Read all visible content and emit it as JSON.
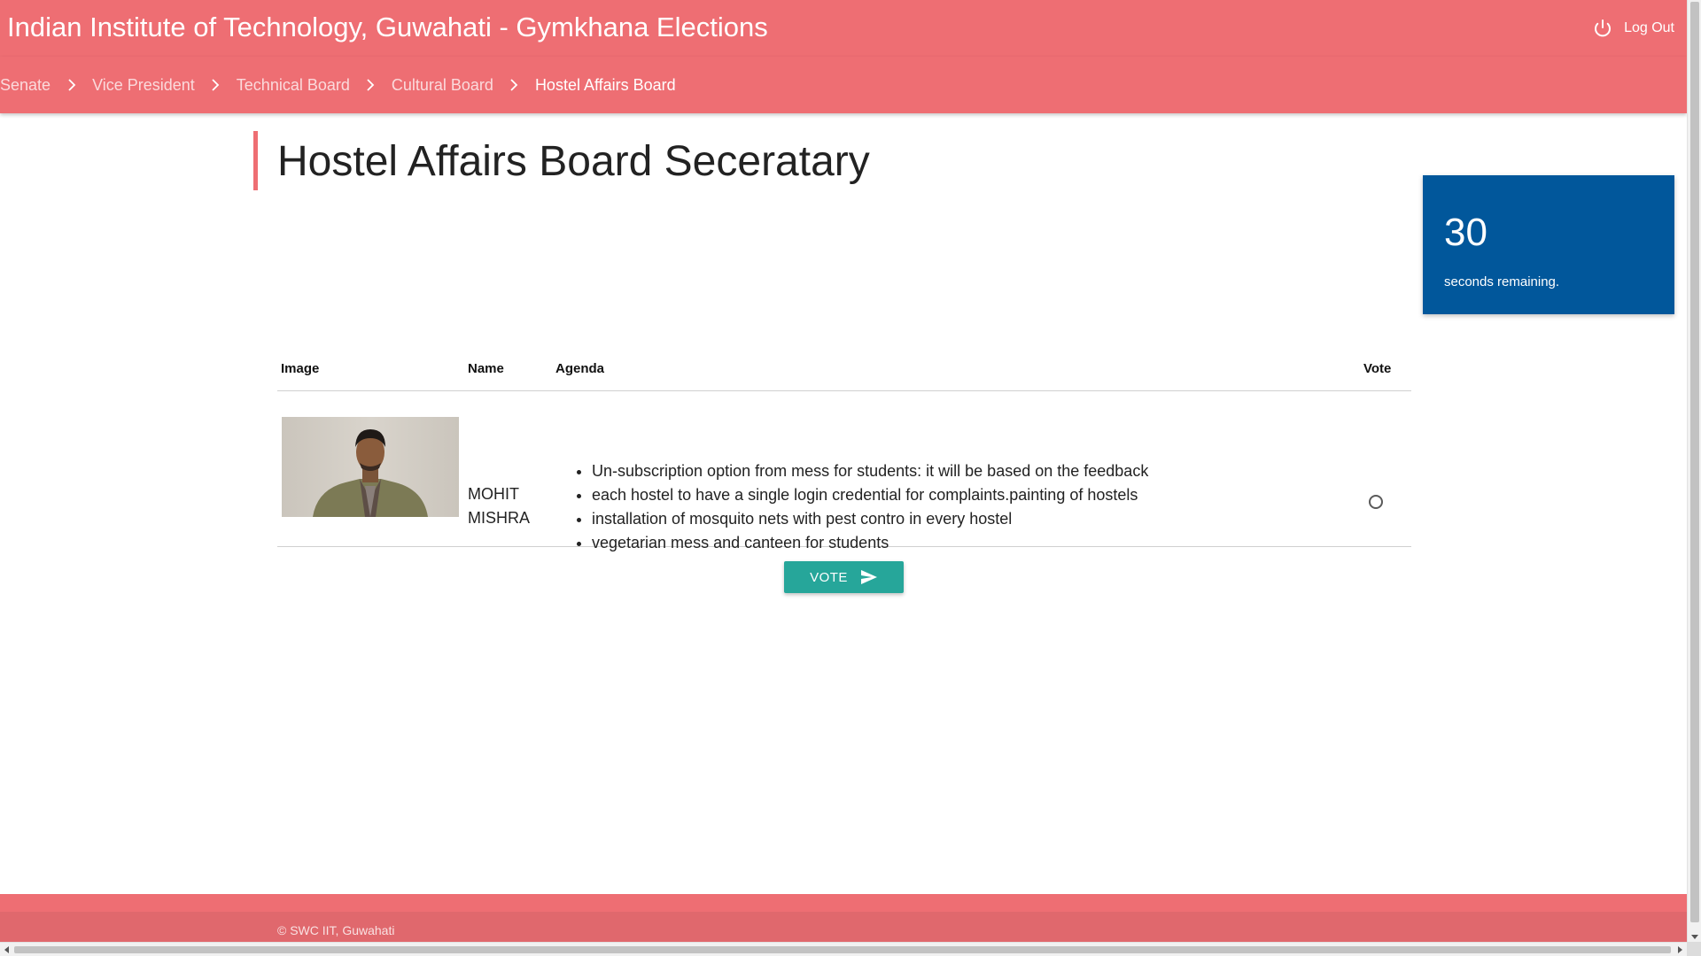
{
  "header": {
    "title": "Indian Institute of Technology, Guwahati - Gymkhana Elections",
    "logout_label": "Log Out",
    "logout_icon": "power-icon"
  },
  "breadcrumb": {
    "items": [
      {
        "label": "Senate",
        "active": false
      },
      {
        "label": "Vice President",
        "active": false
      },
      {
        "label": "Technical Board",
        "active": false
      },
      {
        "label": "Cultural Board",
        "active": false
      },
      {
        "label": "Hostel Affairs Board",
        "active": true
      }
    ],
    "separator_icon": "chevron-right-icon"
  },
  "main": {
    "title": "Hostel Affairs Board Seceratary"
  },
  "timer": {
    "count": "30",
    "label": "seconds remaining."
  },
  "table": {
    "headers": {
      "image": "Image",
      "name": "Name",
      "agenda": "Agenda",
      "vote": "Vote"
    },
    "rows": [
      {
        "name_first": "MOHIT",
        "name_last": "MISHRA",
        "photo_icon": "candidate-photo",
        "selected": false,
        "agenda": [
          "Un-subscription option from mess for students: it will be based on the feedback",
          "each hostel to have a single login credential for complaints.painting of hostels",
          "installation of mosquito nets with pest contro in every hostel",
          "vegetarian mess and canteen for students"
        ]
      }
    ]
  },
  "vote_button": {
    "label": "VOTE",
    "icon": "send-icon"
  },
  "footer": {
    "copyright": "© SWC IIT, Guwahati"
  },
  "colors": {
    "primary": "#ee6e73",
    "timer_bg": "#01579b",
    "button": "#26a69a"
  }
}
